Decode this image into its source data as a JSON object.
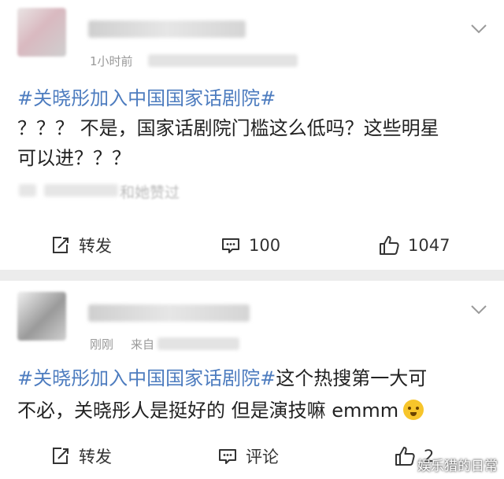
{
  "post1": {
    "time": "1小时前",
    "topic": "#关晓彤加入中国国家话剧院#",
    "text_line1": "？？？ 不是，国家话剧院门槛这么低吗？这些明星",
    "text_line2": "可以进？？？",
    "liked_by": "和她赞过",
    "actions": {
      "repost": "转发",
      "comment": "100",
      "like": "1047"
    }
  },
  "post2": {
    "time": "刚刚",
    "source_prefix": "来自",
    "topic": "#关晓彤加入中国国家话剧院#",
    "text_line1_rest": "这个热搜第一大可",
    "text_line2": "不必，关晓彤人是挺好的 但是演技嘛 emmm",
    "actions": {
      "repost": "转发",
      "comment": "评论",
      "like": "2"
    }
  },
  "watermark": "娱乐猎的日常",
  "colors": {
    "topic": "#4d7cbf",
    "separator": "#ececec",
    "meta": "#999999"
  },
  "icons": [
    "chevron-down-icon",
    "repost-icon",
    "comment-icon",
    "like-icon",
    "sweat-smile-emoji"
  ]
}
